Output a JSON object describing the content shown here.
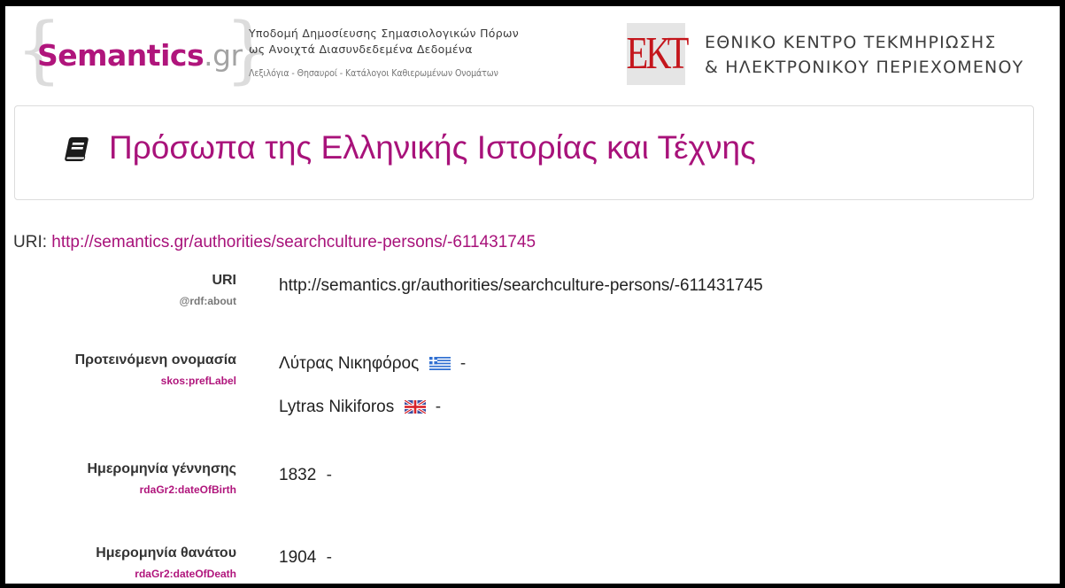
{
  "header": {
    "logo_main": "Semantics",
    "logo_tld": ".gr",
    "tagline_line1": "Υποδομή Δημοσίευσης Σημασιολογικών Πόρων",
    "tagline_line2": "ως Ανοιχτά Διασυνδεδεμένα Δεδομένα",
    "tagline_line3": "Λεξιλόγια - Θησαυροί - Κατάλογοι Καθιερωμένων Ονομάτων",
    "ekt_logo_text": "ΕΚΤ",
    "ekt_name_line1": "ΕΘΝΙΚΟ ΚΕΝΤΡΟ ΤΕΚΜΗΡΙΩΣΗΣ",
    "ekt_name_line2": "& ΗΛΕΚΤΡΟΝΙΚΟΥ ΠΕΡΙΕΧΟΜΕΝΟΥ"
  },
  "page": {
    "title": "Πρόσωπα της Ελληνικής Ιστορίας και Τέχνης",
    "title_icon": "book-icon",
    "uri_label": "URI: ",
    "uri_link": "http://semantics.gr/authorities/searchculture-persons/-611431745"
  },
  "properties": [
    {
      "label": "URI",
      "predicate": "@rdf:about",
      "values": [
        "http://semantics.gr/authorities/searchculture-persons/-611431745"
      ]
    },
    {
      "label": "Προτεινόμενη ονομασία",
      "predicate": "skos:prefLabel",
      "values": [
        {
          "text": "Λύτρας Νικηφόρος",
          "flag": "greek-flag-icon",
          "suffix": "-"
        },
        {
          "text": "Lytras Nikiforos",
          "flag": "uk-flag-icon",
          "suffix": "-"
        }
      ]
    },
    {
      "label": "Ημερομηνία γέννησης",
      "predicate": "rdaGr2:dateOfBirth",
      "values": [
        {
          "text": "1832",
          "suffix": "-"
        }
      ]
    },
    {
      "label": "Ημερομηνία θανάτου",
      "predicate": "rdaGr2:dateOfDeath",
      "values": [
        {
          "text": "1904",
          "suffix": "-"
        }
      ]
    }
  ],
  "colors": {
    "brand_magenta": "#a8127a",
    "ekt_red": "#c4161c",
    "brace_gray": "#dcdcdc"
  }
}
